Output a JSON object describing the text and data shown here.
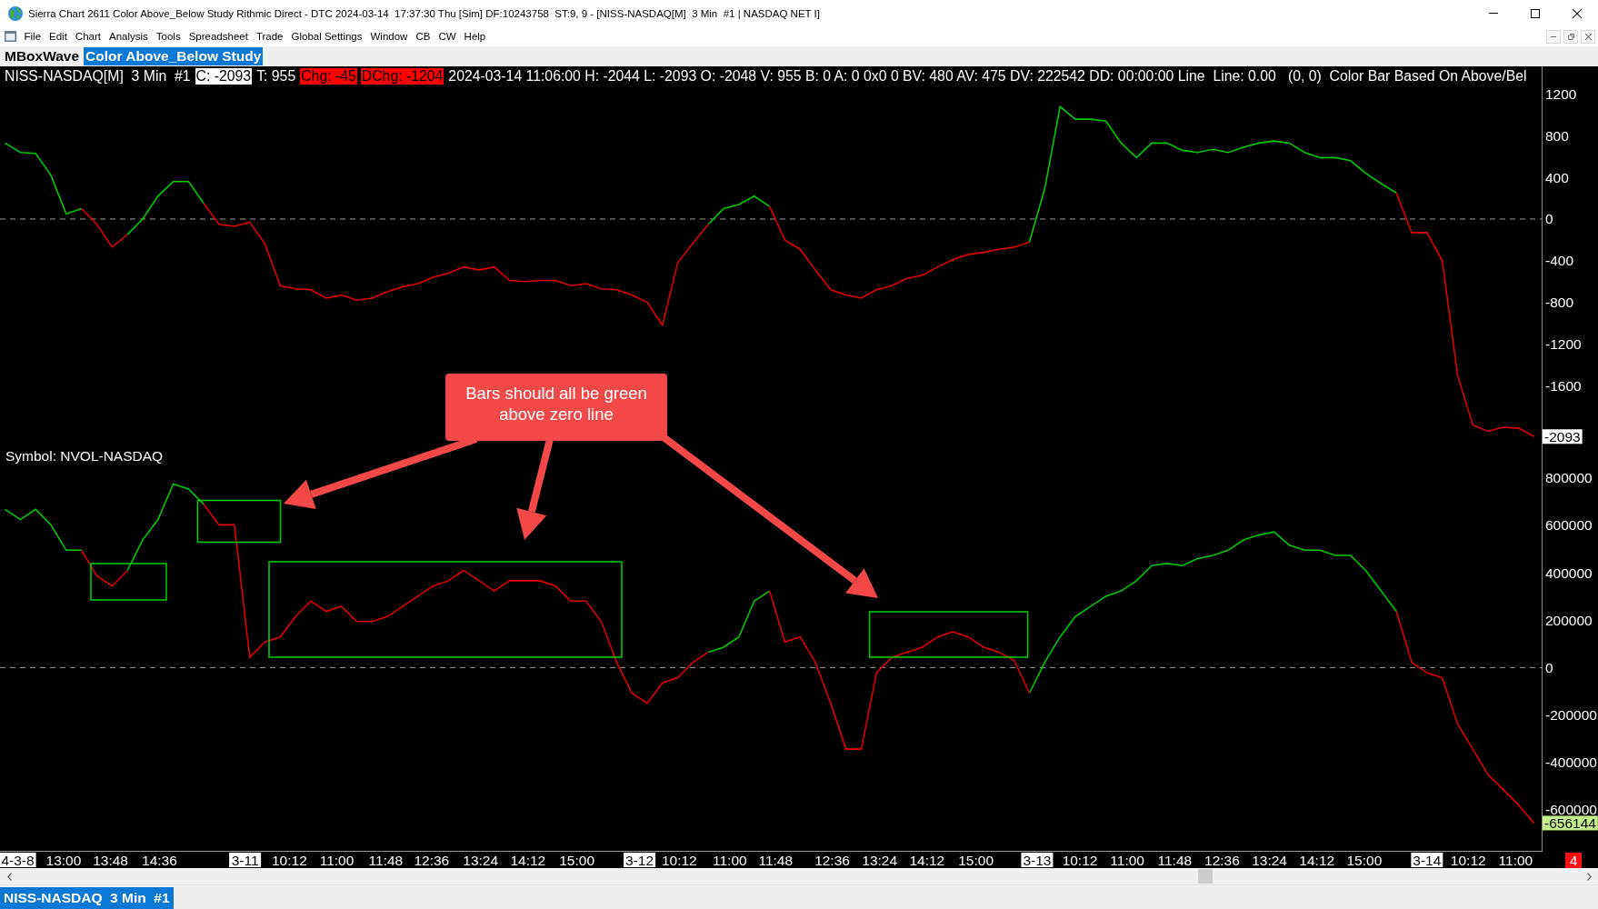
{
  "window": {
    "title": "Sierra Chart 2611 Color Above_Below Study Rithmic Direct - DTC 2024-03-14  17:37:30 Thu [Sim] DF:10243758  ST:9, 9 - [NISS-NASDAQ[M]  3 Min  #1 | NASDAQ NET I]"
  },
  "menu": [
    "File",
    "Edit",
    "Chart",
    "Analysis",
    "Tools",
    "Spreadsheet",
    "Trade",
    "Global Settings",
    "Window",
    "CB",
    "CW",
    "Help"
  ],
  "study_tabs": [
    {
      "label": "MBoxWave",
      "selected": false
    },
    {
      "label": "Color Above_Below Study",
      "selected": true
    }
  ],
  "info_line": [
    {
      "text": "NISS-NASDAQ[M]  3 Min  #1",
      "kind": "plain"
    },
    {
      "text": "C: -2093",
      "kind": "highlight"
    },
    {
      "text": "T: 955",
      "kind": "plain"
    },
    {
      "text": "Chg: -45",
      "kind": "alert"
    },
    {
      "text": "DChg: -1204",
      "kind": "alert"
    },
    {
      "text": "2024-03-14 11:06:00 H: -2044 L: -2093 O: -2048 V: 955 B: 0 A: 0 0x0 0 BV: 480 AV: 475 DV: 222542 DD: 00:00:00 Line  Line: 0.00   (0, 0)  Color Bar Based On Above/Bel",
      "kind": "plain"
    }
  ],
  "charts": [
    {
      "chart_data": {
        "type": "line",
        "ylim": [
          -2175,
          1467
        ],
        "yticks": [
          1200,
          800,
          400,
          0,
          -400,
          -800,
          -1200,
          -1600
        ],
        "series": [
          {
            "color": "#00c800",
            "values": [
              730,
              640,
              630,
              420,
              50,
              100,
              null,
              null,
              -150,
              0,
              220,
              360,
              360,
              150,
              null,
              null,
              null,
              null,
              null,
              null,
              null,
              null,
              null,
              null,
              null,
              null,
              null,
              null,
              null,
              null,
              null,
              null,
              null,
              null,
              null,
              null,
              null,
              null,
              null,
              null,
              null,
              null,
              null,
              null,
              null,
              null,
              -50,
              100,
              140,
              220,
              120,
              null,
              null,
              null,
              null,
              null,
              null,
              null,
              null,
              null,
              null,
              null,
              null,
              null,
              null,
              null,
              null,
              -220,
              290,
              1080,
              960,
              960,
              940,
              730,
              590,
              730,
              730,
              660,
              640,
              670,
              640,
              690,
              730,
              750,
              730,
              640,
              590,
              590,
              560,
              440,
              340,
              250,
              null,
              null,
              null,
              null,
              null,
              null,
              null,
              null,
              null
            ]
          },
          {
            "color": "#e00000",
            "values": [
              null,
              null,
              null,
              null,
              null,
              100,
              -50,
              -270,
              -150,
              null,
              null,
              null,
              null,
              150,
              -50,
              -70,
              -30,
              -240,
              -640,
              -670,
              -680,
              -760,
              -730,
              -780,
              -760,
              -700,
              -650,
              -620,
              -560,
              -520,
              -460,
              -490,
              -460,
              -590,
              -600,
              -590,
              -590,
              -640,
              -620,
              -670,
              -680,
              -730,
              -800,
              -1020,
              -420,
              -230,
              -50,
              null,
              null,
              null,
              120,
              -200,
              -290,
              -490,
              -680,
              -730,
              -760,
              -680,
              -640,
              -570,
              -540,
              -460,
              -390,
              -340,
              -320,
              -290,
              -270,
              -220,
              null,
              null,
              null,
              null,
              null,
              null,
              null,
              null,
              null,
              null,
              null,
              null,
              null,
              null,
              null,
              null,
              null,
              null,
              null,
              null,
              null,
              null,
              null,
              250,
              -130,
              -130,
              -400,
              -1500,
              -1980,
              -2040,
              -2000,
              -2010,
              -2090
            ]
          }
        ],
        "ref_lines": [
          {
            "axis": "y",
            "value": 0
          }
        ],
        "annotations": [
          "-2093"
        ]
      }
    },
    {
      "chart_data": {
        "type": "line",
        "title": "Symbol: NVOL-NASDAQ",
        "ylim": [
          -777000,
          937000
        ],
        "yticks": [
          800000,
          600000,
          400000,
          200000,
          0,
          -200000,
          -400000,
          -600000
        ],
        "series": [
          {
            "color": "#00c800",
            "values": [
              667000,
              624000,
              667000,
              602000,
              495000,
              495000,
              null,
              null,
              409000,
              538000,
              624000,
              774000,
              753000,
              688000,
              null,
              null,
              null,
              null,
              null,
              null,
              null,
              null,
              null,
              null,
              null,
              null,
              null,
              null,
              null,
              null,
              null,
              null,
              null,
              null,
              null,
              null,
              null,
              null,
              null,
              null,
              null,
              null,
              null,
              null,
              null,
              null,
              65000,
              86000,
              129000,
              280000,
              323000,
              null,
              null,
              null,
              null,
              null,
              null,
              null,
              null,
              null,
              null,
              null,
              null,
              null,
              null,
              null,
              null,
              -108000,
              22000,
              129000,
              215000,
              258000,
              301000,
              323000,
              366000,
              430000,
              439000,
              430000,
              460000,
              473000,
              495000,
              538000,
              559000,
              572000,
              516000,
              495000,
              495000,
              473000,
              473000,
              409000,
              323000,
              237000,
              null,
              null,
              null,
              null,
              null,
              null,
              null,
              null,
              null
            ]
          },
          {
            "color": "#e00000",
            "values": [
              null,
              null,
              null,
              null,
              null,
              495000,
              387000,
              344000,
              409000,
              null,
              null,
              null,
              null,
              688000,
              602000,
              602000,
              43000,
              108000,
              129000,
              215000,
              280000,
              237000,
              258000,
              194000,
              194000,
              215000,
              258000,
              301000,
              344000,
              366000,
              409000,
              366000,
              323000,
              366000,
              366000,
              366000,
              344000,
              280000,
              280000,
              194000,
              22000,
              -108000,
              -151000,
              -65000,
              -43000,
              22000,
              65000,
              null,
              null,
              null,
              323000,
              108000,
              129000,
              22000,
              -151000,
              -344000,
              -344000,
              -22000,
              43000,
              65000,
              86000,
              129000,
              151000,
              129000,
              86000,
              65000,
              30000,
              -108000,
              null,
              null,
              null,
              null,
              null,
              null,
              null,
              null,
              null,
              null,
              null,
              null,
              null,
              null,
              null,
              null,
              null,
              null,
              null,
              null,
              null,
              null,
              null,
              237000,
              22000,
              -22000,
              -43000,
              -237000,
              -344000,
              -452000,
              -516000,
              -581000,
              -656000
            ]
          }
        ],
        "ref_lines": [
          {
            "axis": "y",
            "value": 0
          }
        ],
        "annotations": [
          "-656144"
        ]
      }
    }
  ],
  "time_axis": [
    {
      "label": "4-3-8",
      "kind": "date"
    },
    {
      "label": "13:00",
      "kind": "time"
    },
    {
      "label": "13:48",
      "kind": "time"
    },
    {
      "label": "14:36",
      "kind": "time"
    },
    {
      "label": "3-11",
      "kind": "date"
    },
    {
      "label": "10:12",
      "kind": "time"
    },
    {
      "label": "11:00",
      "kind": "time"
    },
    {
      "label": "11:48",
      "kind": "time"
    },
    {
      "label": "12:36",
      "kind": "time"
    },
    {
      "label": "13:24",
      "kind": "time"
    },
    {
      "label": "14:12",
      "kind": "time"
    },
    {
      "label": "15:00",
      "kind": "time"
    },
    {
      "label": "3-12",
      "kind": "date"
    },
    {
      "label": "10:12",
      "kind": "time"
    },
    {
      "label": "11:00",
      "kind": "time"
    },
    {
      "label": "11:48",
      "kind": "time"
    },
    {
      "label": "12:36",
      "kind": "time"
    },
    {
      "label": "13:24",
      "kind": "time"
    },
    {
      "label": "14:12",
      "kind": "time"
    },
    {
      "label": "15:00",
      "kind": "time"
    },
    {
      "label": "3-13",
      "kind": "date"
    },
    {
      "label": "10:12",
      "kind": "time"
    },
    {
      "label": "11:00",
      "kind": "time"
    },
    {
      "label": "11:48",
      "kind": "time"
    },
    {
      "label": "12:36",
      "kind": "time"
    },
    {
      "label": "13:24",
      "kind": "time"
    },
    {
      "label": "14:12",
      "kind": "time"
    },
    {
      "label": "15:00",
      "kind": "time"
    },
    {
      "label": "3-14",
      "kind": "date"
    },
    {
      "label": "10:12",
      "kind": "time"
    },
    {
      "label": "11:00",
      "kind": "time"
    }
  ],
  "axis_badge": "4",
  "callout": {
    "text": "Bars should all be green above zero line"
  },
  "chartbook_tabs": [
    {
      "label": "NISS-NASDAQ  3 Min  #1",
      "selected": true
    }
  ]
}
